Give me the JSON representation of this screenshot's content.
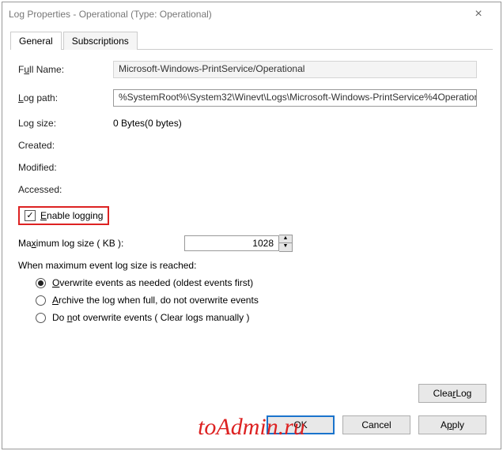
{
  "window": {
    "title": "Log Properties - Operational (Type: Operational)"
  },
  "tabs": {
    "general": "General",
    "subscriptions": "Subscriptions"
  },
  "fields": {
    "fullname_label_pre": "F",
    "fullname_label_u": "u",
    "fullname_label_post": "ll Name:",
    "fullname_value": "Microsoft-Windows-PrintService/Operational",
    "logpath_label_pre": "",
    "logpath_label_u": "L",
    "logpath_label_post": "og path:",
    "logpath_value": "%SystemRoot%\\System32\\Winevt\\Logs\\Microsoft-Windows-PrintService%4Operation",
    "logsize_label": "Log size:",
    "logsize_value": "0 Bytes(0 bytes)",
    "created_label": "Created:",
    "created_value": "",
    "modified_label": "Modified:",
    "modified_value": "",
    "accessed_label": "Accessed:",
    "accessed_value": ""
  },
  "enable": {
    "label_pre": "",
    "label_u": "E",
    "label_post": "nable logging",
    "checked": true
  },
  "maxsize": {
    "label_pre": "Ma",
    "label_u": "x",
    "label_post": "imum log size ( KB ):",
    "value": "1028"
  },
  "when_label": "When maximum event log size is reached:",
  "radios": {
    "r1_pre": "",
    "r1_u": "O",
    "r1_mid": "verwrite events as needed (oldest events first)",
    "r2_pre": "",
    "r2_u": "A",
    "r2_mid": "rchive the log when full, do not overwrite events",
    "r3_pre": "Do ",
    "r3_u": "n",
    "r3_mid": "ot overwrite events ( Clear logs manually )",
    "selected": 1
  },
  "buttons": {
    "clearlog_pre": "Clea",
    "clearlog_u": "r",
    "clearlog_post": " Log",
    "ok": "OK",
    "cancel": "Cancel",
    "apply_pre": "A",
    "apply_u": "p",
    "apply_post": "ply"
  },
  "watermark": "toAdmin.ru"
}
